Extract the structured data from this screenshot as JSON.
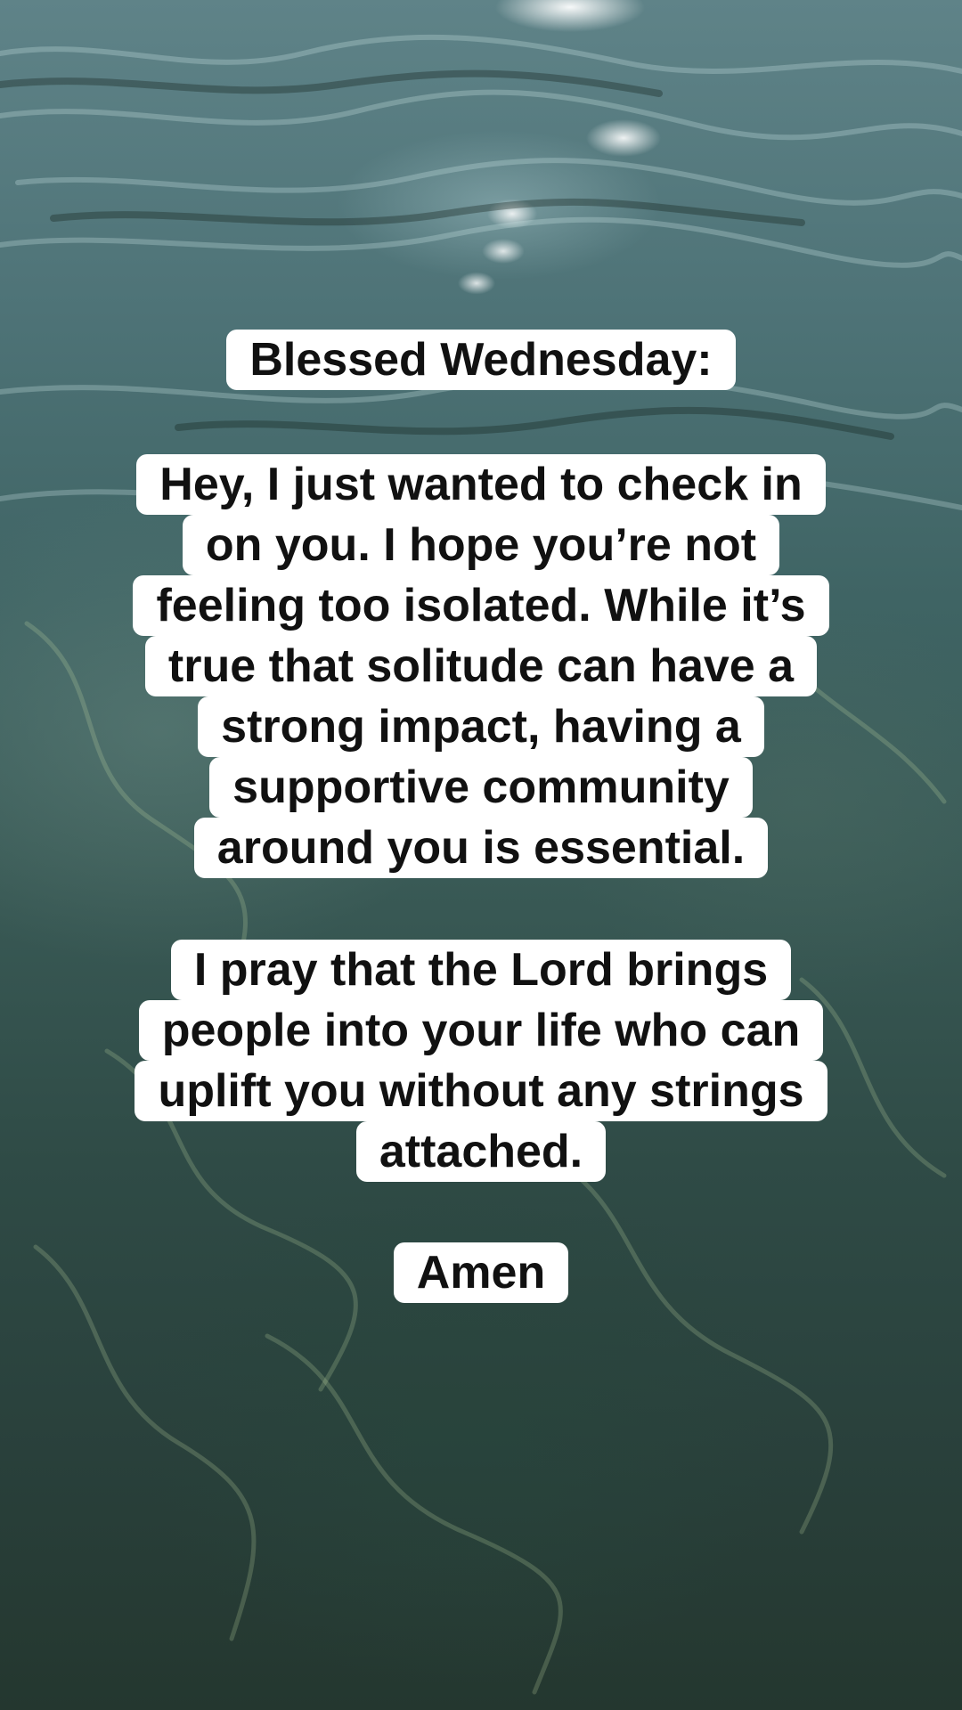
{
  "post": {
    "title": "Blessed Wednesday:",
    "paragraph1": [
      "Hey, I just wanted to check in",
      "on you. I hope you’re not",
      "feeling too isolated. While it’s",
      "true that solitude can have a",
      "strong impact, having a",
      "supportive community",
      "around you is essential."
    ],
    "paragraph2": [
      "I pray that the Lord brings",
      "people into your life who can",
      "uplift you without any strings",
      "attached."
    ],
    "closing": "Amen"
  },
  "colors": {
    "text": "#111111",
    "label_background": "#ffffff",
    "water_top": "#5f8388",
    "water_bottom": "#24372f"
  }
}
